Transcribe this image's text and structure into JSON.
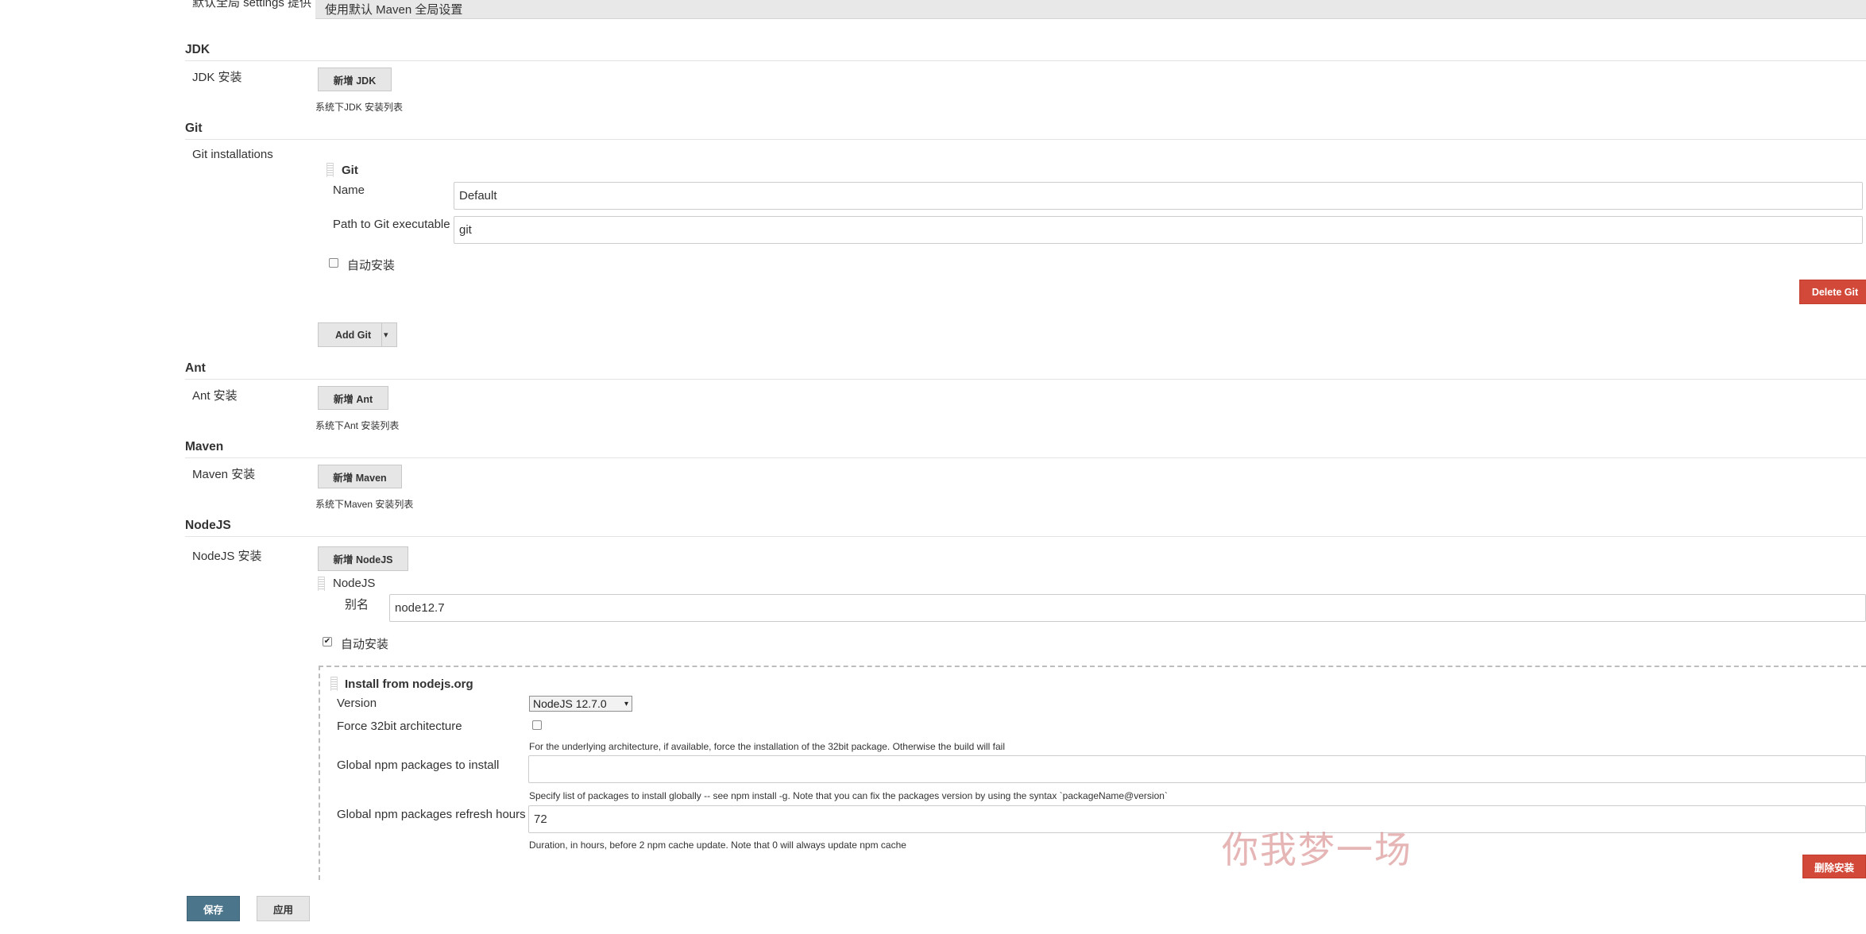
{
  "top": {
    "settings_label": "默认全局 settings 提供",
    "settings_value": "使用默认 Maven 全局设置"
  },
  "jdk": {
    "title": "JDK",
    "label": "JDK 安装",
    "add_button": "新增 JDK",
    "help": "系统下JDK 安装列表"
  },
  "git": {
    "title": "Git",
    "label": "Git installations",
    "item_title": "Git",
    "name_label": "Name",
    "name_value": "Default",
    "path_label": "Path to Git executable",
    "path_value": "git",
    "auto_install_label": "自动安装",
    "auto_install_checked": false,
    "delete_button": "Delete Git",
    "add_button": "Add Git",
    "add_caret": "▾"
  },
  "ant": {
    "title": "Ant",
    "label": "Ant 安装",
    "add_button": "新增 Ant",
    "help": "系统下Ant 安装列表"
  },
  "maven": {
    "title": "Maven",
    "label": "Maven 安装",
    "add_button": "新增 Maven",
    "help": "系统下Maven 安装列表"
  },
  "nodejs": {
    "title": "NodeJS",
    "label": "NodeJS 安装",
    "add_button": "新增 NodeJS",
    "item_title": "NodeJS",
    "alias_label": "别名",
    "alias_value": "node12.7",
    "auto_install_label": "自动安装",
    "auto_install_checked": true,
    "installer": {
      "title": "Install from nodejs.org",
      "version_label": "Version",
      "version_value": "NodeJS 12.7.0",
      "force32_label": "Force 32bit architecture",
      "force32_checked": false,
      "force32_help": "For the underlying architecture, if available, force the installation of the 32bit package. Otherwise the build will fail",
      "npm_label": "Global npm packages to install",
      "npm_value": "",
      "npm_help": "Specify list of packages to install globally -- see npm install -g. Note that you can fix the packages version by using the syntax `packageName@version`",
      "refresh_label": "Global npm packages refresh hours",
      "refresh_value": "72",
      "refresh_help": "Duration, in hours, before 2 npm cache update. Note that 0 will always update npm cache",
      "delete_button": "删除安装"
    }
  },
  "footer": {
    "save_button": "保存",
    "apply_button": "应用"
  },
  "watermark": "你我梦一场",
  "icons": {
    "drag_handle": "drag-handle-icon",
    "check": "✔",
    "dropdown_caret": "▾"
  },
  "colors": {
    "danger": "#d24939",
    "primary": "#4b758b",
    "button_gray": "#e6e6e6"
  }
}
